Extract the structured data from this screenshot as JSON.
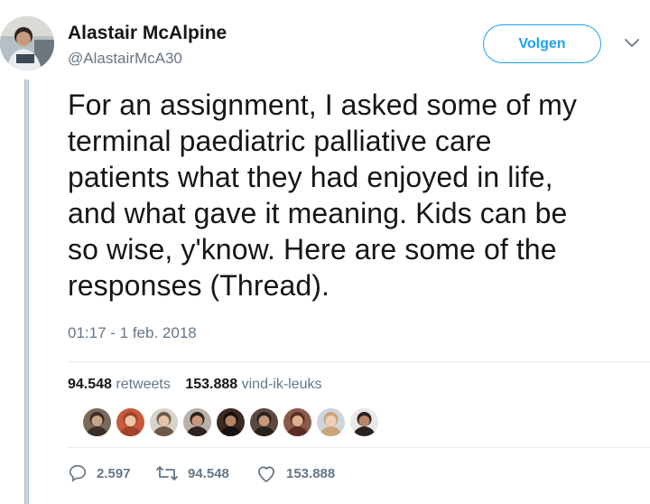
{
  "author": {
    "name": "Alastair McAlpine",
    "handle": "@AlastairMcA30"
  },
  "follow_label": "Volgen",
  "tweet": {
    "lines": [
      "For an assignment, I asked some of my",
      "terminal paediatric palliative care",
      "patients what they had enjoyed in life,",
      "and what gave it meaning. Kids can be",
      "so wise, y'know. Here are some of the",
      "responses (Thread)."
    ],
    "timestamp": "01:17 - 1 feb. 2018"
  },
  "stats": {
    "retweets_count": "94.548",
    "retweets_label": "retweets",
    "likes_count": "153.888",
    "likes_label": "vind-ik-leuks"
  },
  "likers_count": 9,
  "actions": {
    "reply_count": "2.597",
    "retweet_count": "94.548",
    "like_count": "153.888"
  },
  "colors": {
    "accent": "#1da1f2",
    "muted": "#657786",
    "text": "#14171a",
    "thread_line": "#c4d6e6"
  },
  "icons": [
    "avatar",
    "chevron-down-icon",
    "reply-icon",
    "retweet-icon",
    "heart-icon"
  ]
}
